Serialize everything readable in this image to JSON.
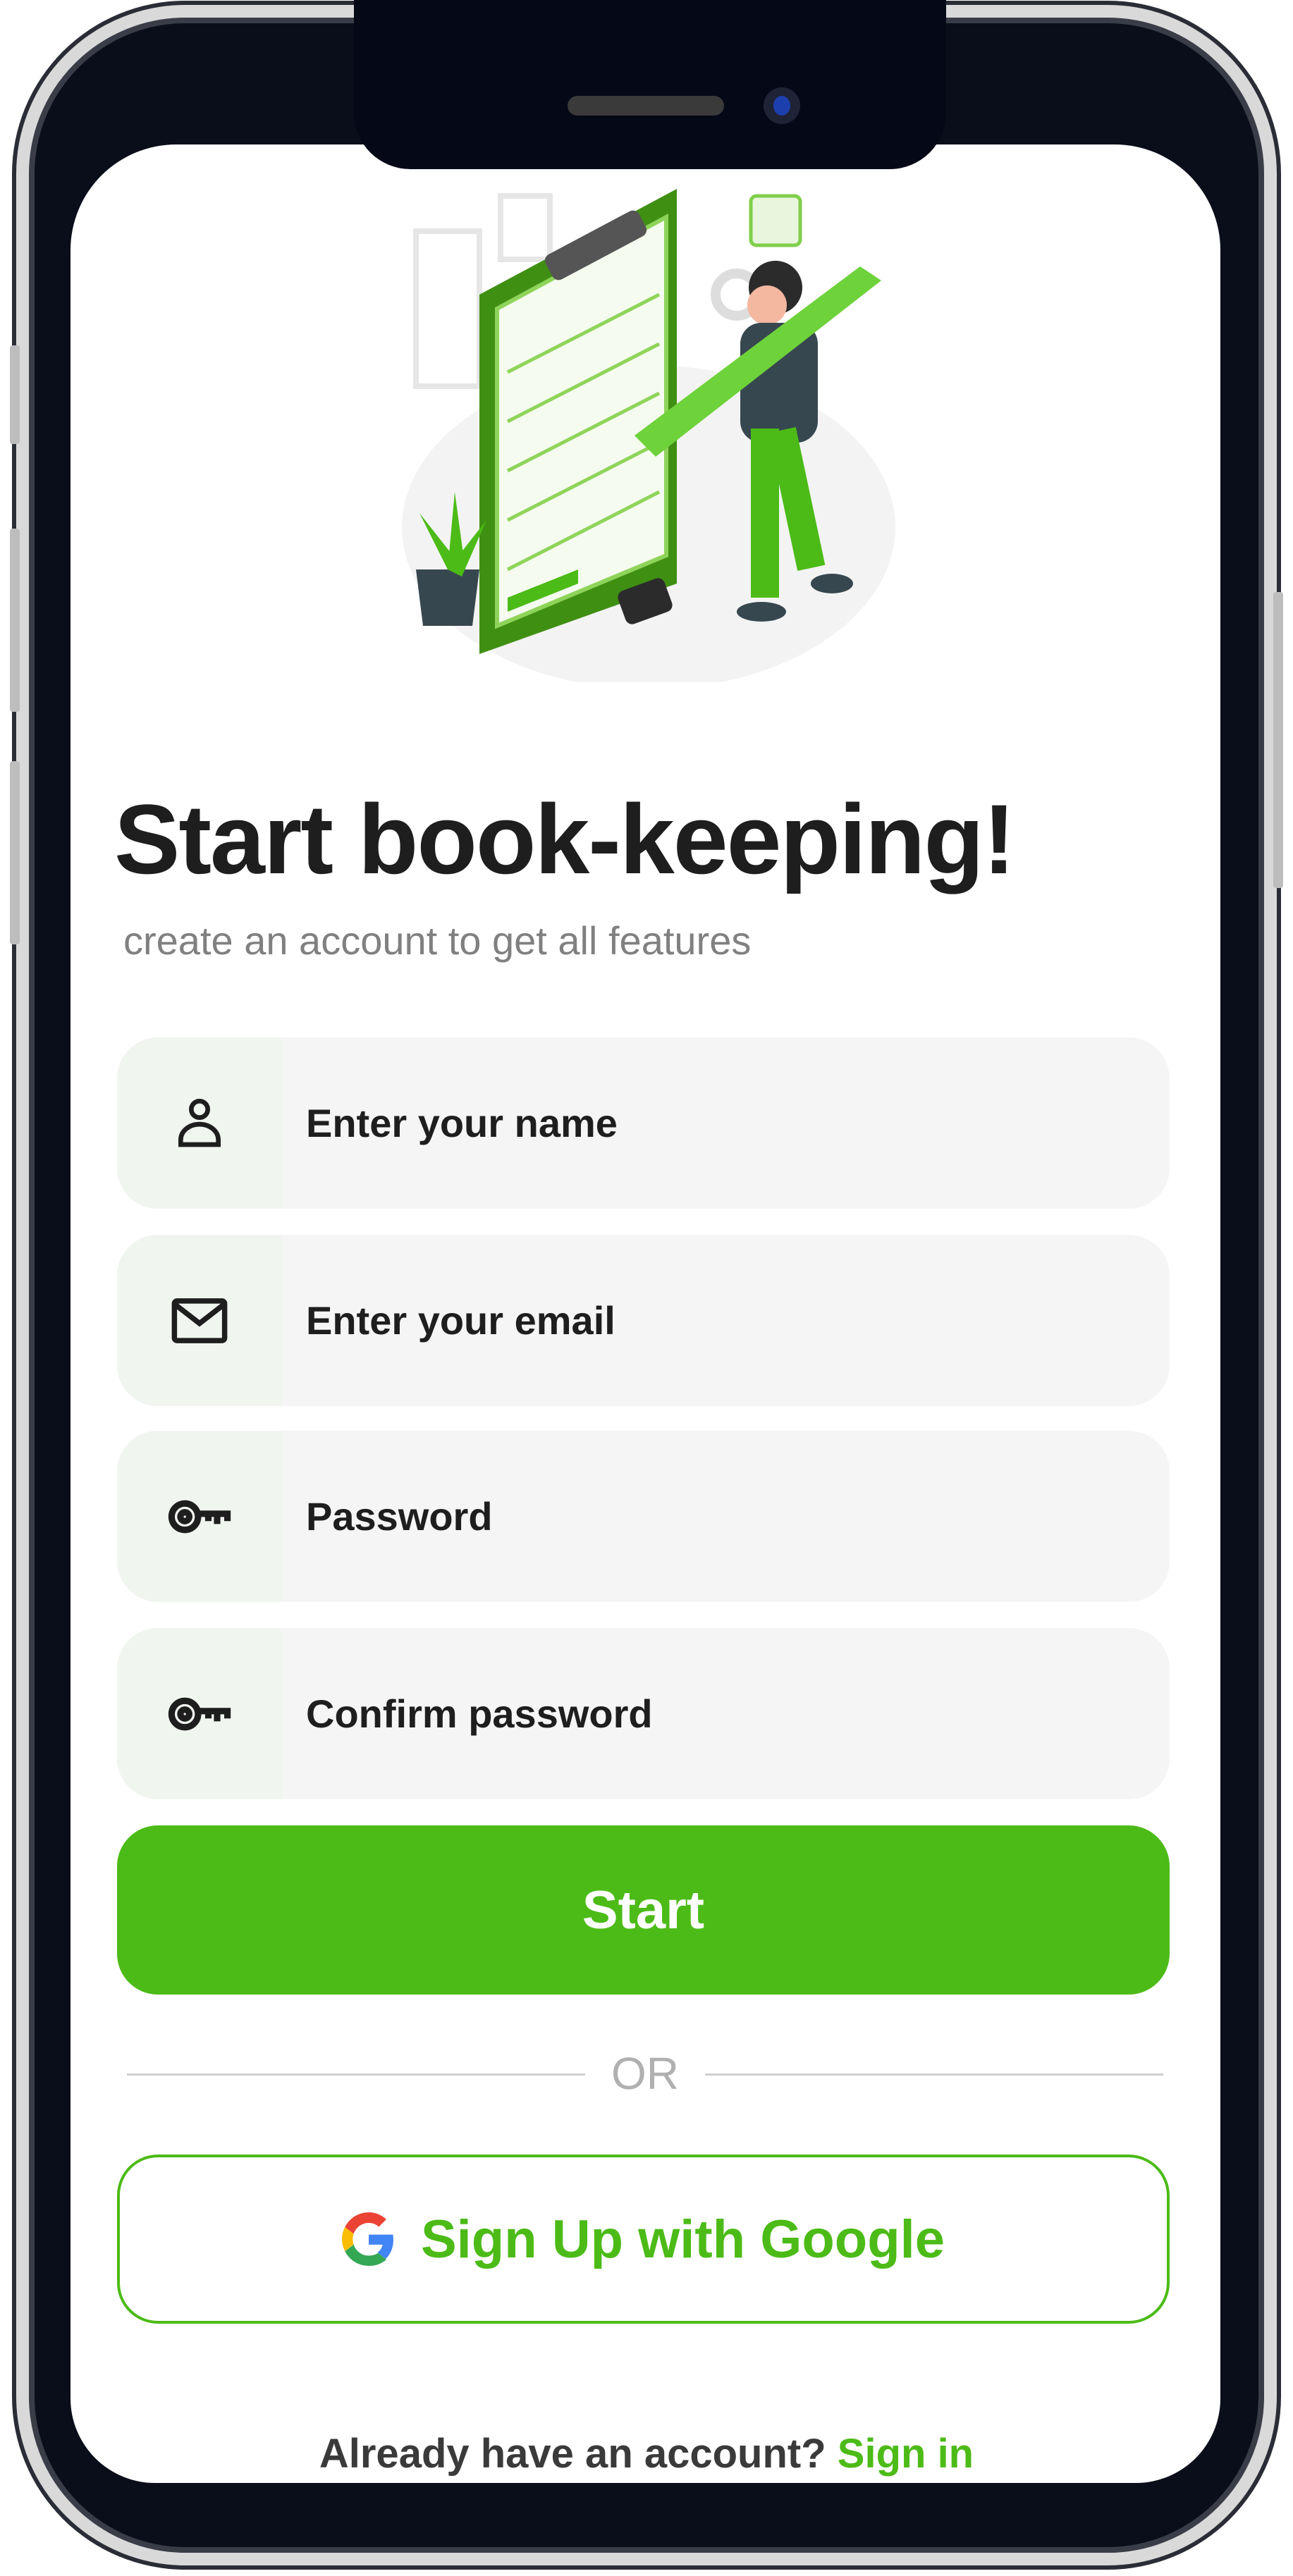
{
  "header": {
    "title": "Start book-keeping!",
    "subtitle": "create an account to get all features"
  },
  "form": {
    "fields": [
      {
        "icon": "person-icon",
        "placeholder": "Enter your name"
      },
      {
        "icon": "mail-icon",
        "placeholder": "Enter your email"
      },
      {
        "icon": "key-icon",
        "placeholder": "Password"
      },
      {
        "icon": "key-icon",
        "placeholder": "Confirm password"
      }
    ],
    "submit_label": "Start",
    "divider": "OR",
    "google_label": "Sign Up with Google"
  },
  "footer": {
    "prompt": "Already have an account?",
    "link": "Sign in"
  },
  "colors": {
    "accent": "#4cbb17",
    "field_bg": "#f5f5f5",
    "title": "#1e1e1e"
  }
}
